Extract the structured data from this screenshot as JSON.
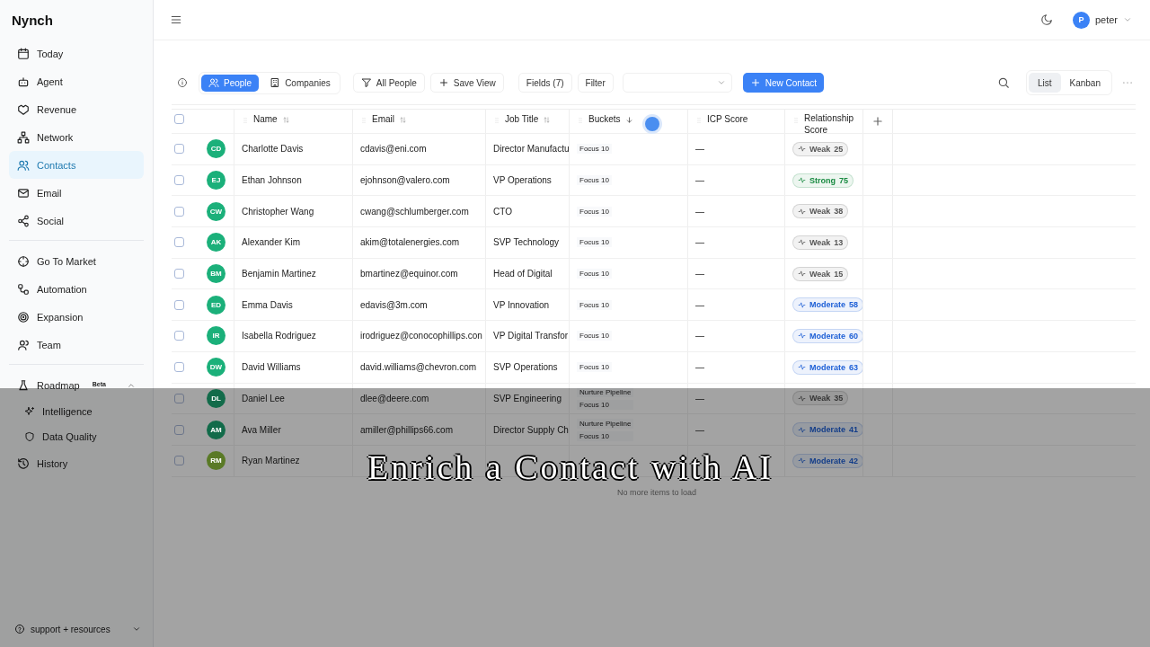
{
  "sidebar": {
    "brand": "Nynch",
    "groups": [
      [
        {
          "label": "Today",
          "selected": false
        },
        {
          "label": "Agent",
          "selected": false
        },
        {
          "label": "Revenue",
          "selected": false
        },
        {
          "label": "Network",
          "selected": false
        },
        {
          "label": "Contacts",
          "selected": true
        },
        {
          "label": "Email",
          "selected": false
        },
        {
          "label": "Social",
          "selected": false
        }
      ],
      [
        {
          "label": "Go To Market",
          "selected": false
        },
        {
          "label": "Automation",
          "selected": false
        },
        {
          "label": "Expansion",
          "selected": false
        },
        {
          "label": "Team",
          "selected": false
        }
      ]
    ],
    "roadmap": {
      "label": "Roadmap",
      "badge": "Beta",
      "expanded": true,
      "children": [
        {
          "label": "Intelligence"
        },
        {
          "label": "Data Quality"
        }
      ]
    },
    "history": "History",
    "footer": "support + resources"
  },
  "header": {
    "user": {
      "initial": "P",
      "name": "peter"
    }
  },
  "toolbar": {
    "tabs": [
      {
        "label": "People",
        "selected": true
      },
      {
        "label": "Companies",
        "selected": false
      }
    ],
    "view": "All People",
    "save_view": "Save View",
    "fields": "Fields (7)",
    "filter": "Filter",
    "new_button": "New Contact",
    "modes": [
      {
        "label": "List",
        "selected": true
      },
      {
        "label": "Kanban",
        "selected": false
      }
    ]
  },
  "table": {
    "select_all_checked": false,
    "columns": [
      {
        "label": "Name",
        "sortable": true
      },
      {
        "label": "Email",
        "sortable": true
      },
      {
        "label": "Job Title",
        "sortable": true
      },
      {
        "label": "Buckets",
        "sorted": true
      },
      {
        "label": "ICP Score"
      },
      {
        "label": "Relationship Score"
      }
    ],
    "rows": [
      {
        "checked": false,
        "avatar": {
          "initials": "CD",
          "color": "#1bb07a"
        },
        "name": "Charlotte Davis",
        "email": "cdavis@eni.com",
        "job": "Director Manufactu",
        "buckets": [
          "Focus 10"
        ],
        "icp": "—",
        "badge": {
          "label": "Weak",
          "score": "25",
          "color": "#555555"
        }
      },
      {
        "checked": false,
        "avatar": {
          "initials": "EJ",
          "color": "#1bb07a"
        },
        "name": "Ethan Johnson",
        "email": "ejohnson@valero.com",
        "job": "VP Operations",
        "buckets": [
          "Focus 10"
        ],
        "icp": "—",
        "badge": {
          "label": "Strong",
          "score": "75",
          "color": "#178a40"
        }
      },
      {
        "checked": false,
        "avatar": {
          "initials": "CW",
          "color": "#1bb07a"
        },
        "name": "Christopher Wang",
        "email": "cwang@schlumberger.com",
        "job": "CTO",
        "buckets": [
          "Focus 10"
        ],
        "icp": "—",
        "badge": {
          "label": "Weak",
          "score": "38",
          "color": "#555555"
        }
      },
      {
        "checked": false,
        "avatar": {
          "initials": "AK",
          "color": "#1bb07a"
        },
        "name": "Alexander Kim",
        "email": "akim@totalenergies.com",
        "job": "SVP Technology",
        "buckets": [
          "Focus 10"
        ],
        "icp": "—",
        "badge": {
          "label": "Weak",
          "score": "13",
          "color": "#555555"
        }
      },
      {
        "checked": false,
        "avatar": {
          "initials": "BM",
          "color": "#1bb07a"
        },
        "name": "Benjamin Martinez",
        "email": "bmartinez@equinor.com",
        "job": "Head of Digital",
        "buckets": [
          "Focus 10"
        ],
        "icp": "—",
        "badge": {
          "label": "Weak",
          "score": "15",
          "color": "#555555"
        }
      },
      {
        "checked": false,
        "avatar": {
          "initials": "ED",
          "color": "#1bb07a"
        },
        "name": "Emma Davis",
        "email": "edavis@3m.com",
        "job": "VP Innovation",
        "buckets": [
          "Focus 10"
        ],
        "icp": "—",
        "badge": {
          "label": "Moderate",
          "score": "58",
          "color": "#1d5fd6"
        }
      },
      {
        "checked": false,
        "avatar": {
          "initials": "IR",
          "color": "#1bb07a"
        },
        "name": "Isabella Rodriguez",
        "email": "irodriguez@conocophillips.con",
        "job": "VP Digital Transfor",
        "buckets": [
          "Focus 10"
        ],
        "icp": "—",
        "badge": {
          "label": "Moderate",
          "score": "60",
          "color": "#1d5fd6"
        }
      },
      {
        "checked": false,
        "avatar": {
          "initials": "DW",
          "color": "#1bb07a"
        },
        "name": "David Williams",
        "email": "david.williams@chevron.com",
        "job": "SVP Operations",
        "buckets": [
          "Focus 10"
        ],
        "icp": "—",
        "badge": {
          "label": "Moderate",
          "score": "63",
          "color": "#1d5fd6"
        }
      },
      {
        "checked": false,
        "avatar": {
          "initials": "DL",
          "color": "#126b4a"
        },
        "name": "Daniel Lee",
        "email": "dlee@deere.com",
        "job": "SVP Engineering",
        "buckets": [
          "Nurture Pipeline",
          "Focus 10"
        ],
        "icp": "—",
        "badge": {
          "label": "Weak",
          "score": "35",
          "color": "#363636"
        }
      },
      {
        "checked": false,
        "avatar": {
          "initials": "AM",
          "color": "#126b4a"
        },
        "name": "Ava Miller",
        "email": "amiller@phillips66.com",
        "job": "Director Supply Ch",
        "buckets": [
          "Nurture Pipeline",
          "Focus 10"
        ],
        "icp": "—",
        "badge": {
          "label": "Moderate",
          "score": "41",
          "color": "#133d89"
        }
      },
      {
        "checked": false,
        "avatar": {
          "initials": "RM",
          "color": "#5a7a26"
        },
        "name": "Ryan Martinez",
        "badge": {
          "label": "Moderate",
          "score": "42",
          "color": "#133d89"
        }
      }
    ],
    "end_note": "No more items to load"
  },
  "caption": "Enrich a Contact with AI"
}
